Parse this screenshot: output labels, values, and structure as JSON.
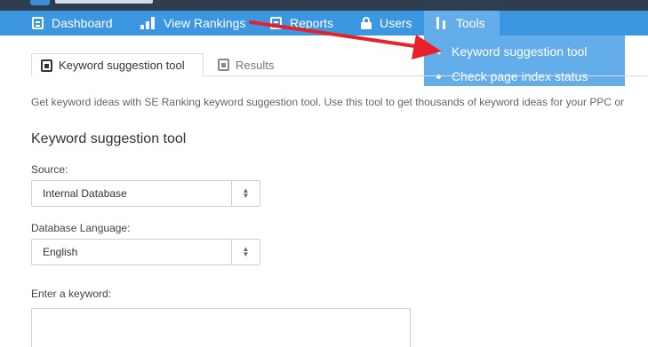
{
  "navbar": {
    "items": [
      {
        "label": "Dashboard",
        "icon": "dashboard-icon"
      },
      {
        "label": "View Rankings",
        "icon": "bar-chart-icon"
      },
      {
        "label": "Reports",
        "icon": "report-icon"
      },
      {
        "label": "Users",
        "icon": "lock-icon"
      },
      {
        "label": "Tools",
        "icon": "tools-icon"
      }
    ],
    "active": "Tools",
    "color": "#3d97e0",
    "active_color": "#63aeea"
  },
  "tools_menu": {
    "items": [
      {
        "label": "Keyword suggestion tool"
      },
      {
        "label": "Check page index status"
      }
    ]
  },
  "tabs": [
    {
      "label": "Keyword suggestion tool",
      "active": true
    },
    {
      "label": "Results",
      "active": false
    }
  ],
  "description": "Get keyword ideas with SE Ranking keyword suggestion tool. Use this tool to get thousands of keyword ideas for your PPC or",
  "form": {
    "title": "Keyword suggestion tool",
    "source_label": "Source:",
    "source_value": "Internal Database",
    "language_label": "Database Language:",
    "language_value": "English",
    "keyword_label": "Enter a keyword:",
    "keyword_value": ""
  },
  "annotation": {
    "color": "#e8202a"
  }
}
